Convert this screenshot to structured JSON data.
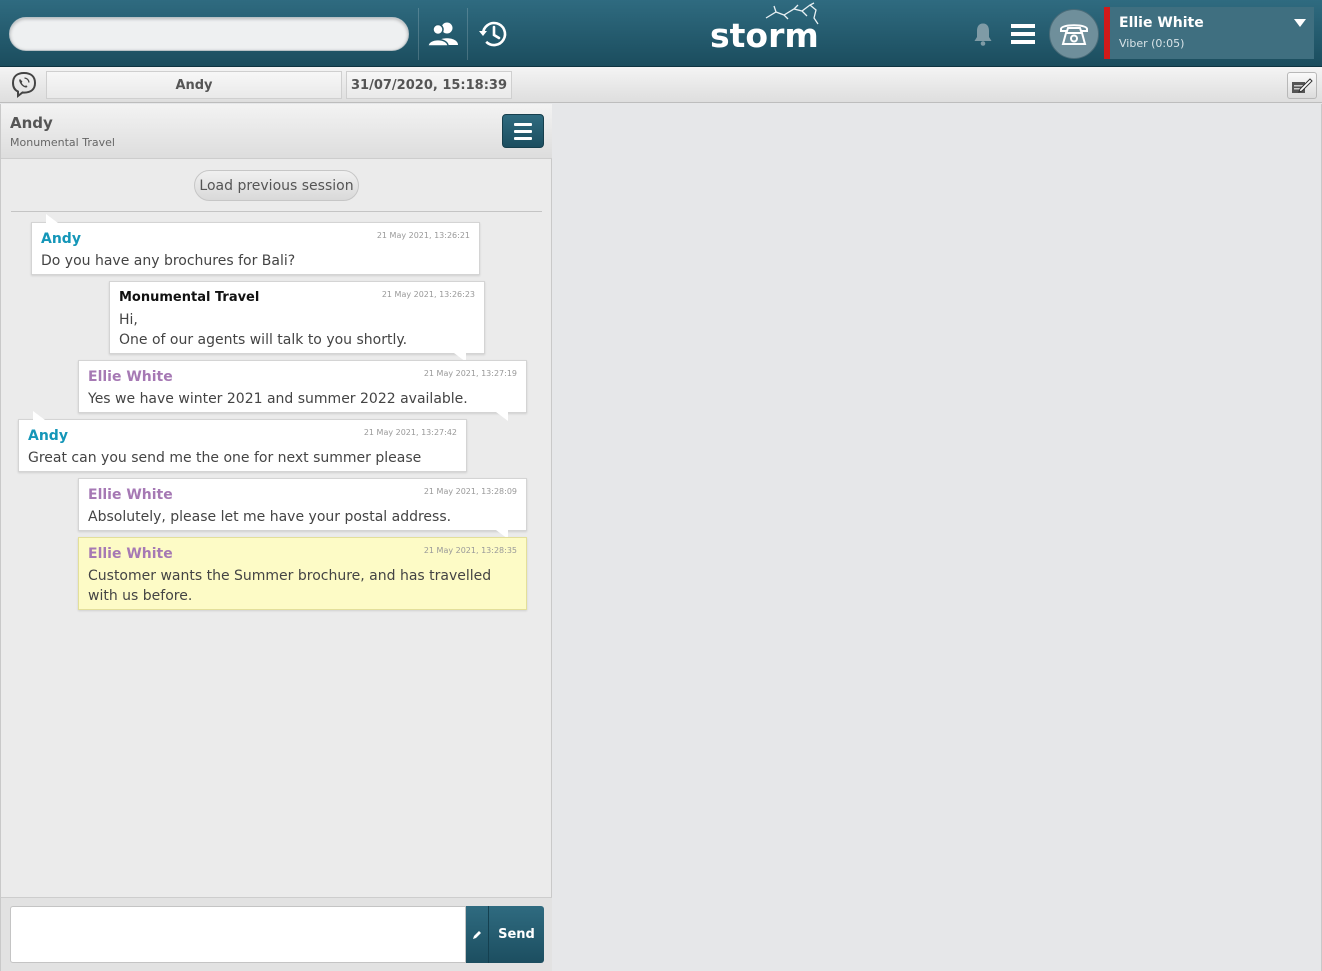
{
  "topbar": {
    "search_placeholder": "",
    "logo_text": "storm",
    "contacts_icon": "contacts-icon",
    "history_icon": "history-icon",
    "bell_icon": "bell-icon",
    "menu_icon": "hamburger-icon",
    "phone_icon": "phone-icon",
    "agent": {
      "name": "Ellie White",
      "status": "Viber (0:05)",
      "status_color": "#d11a1a"
    }
  },
  "subbar": {
    "channel_icon": "viber-icon",
    "contact_name": "Andy",
    "datetime": "31/07/2020, 15:18:39",
    "notes_icon": "notes-edit-icon"
  },
  "chat": {
    "header": {
      "name": "Andy",
      "organization": "Monumental Travel"
    },
    "load_previous_label": "Load previous session",
    "messages": [
      {
        "sender": "Andy",
        "role": "customer",
        "time": "21 May 2021, 13:26:21",
        "text": "Do you have any brochures for Bali?"
      },
      {
        "sender": "Monumental Travel",
        "role": "system",
        "time": "21 May 2021, 13:26:23",
        "text": "Hi,\nOne of our agents will talk to you shortly."
      },
      {
        "sender": "Ellie White",
        "role": "agent",
        "time": "21 May 2021, 13:27:19",
        "text": "Yes we have winter 2021 and summer 2022 available."
      },
      {
        "sender": "Andy",
        "role": "customer",
        "time": "21 May 2021, 13:27:42",
        "text": "Great can you send me the one for next summer please"
      },
      {
        "sender": "Ellie White",
        "role": "agent",
        "time": "21 May 2021, 13:28:09",
        "text": "Absolutely, please let me have your postal address."
      },
      {
        "sender": "Ellie White",
        "role": "agent-note",
        "time": "21 May 2021, 13:28:35",
        "text": "Customer wants the Summer brochure, and has travelled with us before."
      }
    ],
    "composer": {
      "value": "",
      "send_label": "Send"
    }
  },
  "colors": {
    "brand": "#1f5566",
    "customer_name": "#1496b8",
    "agent_name": "#a679b4",
    "note_background": "#fdfbc6"
  }
}
